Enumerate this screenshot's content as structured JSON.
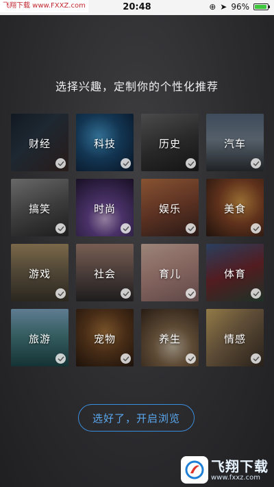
{
  "status": {
    "watermark": "飞翔下载 www.FXXZ.com",
    "time": "20:48",
    "battery_percent": "96%",
    "battery_level": 0.96
  },
  "title": "选择兴趣，定制你的个性化推荐",
  "categories": [
    {
      "label": "财经",
      "selected": true,
      "bg": "linear-gradient(135deg,#1a2430 0%,#2d3b4a 40%,#3b2a26 100%)"
    },
    {
      "label": "科技",
      "selected": true,
      "bg": "radial-gradient(circle at 40% 40%,#4aa3d8 0%,#1c4f7a 45%,#0d1d33 100%)"
    },
    {
      "label": "历史",
      "selected": true,
      "bg": "linear-gradient(160deg,#6e6e6e 0%,#3a3a3a 55%,#1e1e1e 100%)"
    },
    {
      "label": "汽车",
      "selected": true,
      "bg": "linear-gradient(180deg,#5c6f86 0%,#7d8c9c 45%,#2f3438 100%)"
    },
    {
      "label": "搞笑",
      "selected": true,
      "bg": "linear-gradient(160deg,#9a9a9a 0%,#5b5b5b 50%,#2b2b2b 100%)"
    },
    {
      "label": "时尚",
      "selected": true,
      "bg": "radial-gradient(circle at 50% 70%,#d8b9e8 0%,#6d4a9a 35%,#241836 100%)"
    },
    {
      "label": "娱乐",
      "selected": true,
      "bg": "linear-gradient(160deg,#c77a4a 0%,#8a4b34 50%,#3c2520 100%)"
    },
    {
      "label": "美食",
      "selected": true,
      "bg": "radial-gradient(circle at 60% 40%,#e0a14a 0%,#8e4a2a 45%,#2e1c14 100%)"
    },
    {
      "label": "游戏",
      "selected": true,
      "bg": "linear-gradient(180deg,#b59a6c 0%,#7a6a52 45%,#3f3a2e 100%)"
    },
    {
      "label": "社会",
      "selected": true,
      "bg": "linear-gradient(180deg,#b08a7a 0%,#6e5a55 50%,#2d2b2c 100%)"
    },
    {
      "label": "育儿",
      "selected": true,
      "bg": "linear-gradient(160deg,#e6c4b3 0%,#c3938a 50%,#8a6a6a 100%)"
    },
    {
      "label": "体育",
      "selected": true,
      "bg": "linear-gradient(160deg,#3d5e8c 0%,#7a2a30 50%,#2d4a3a 100%)"
    },
    {
      "label": "旅游",
      "selected": true,
      "bg": "linear-gradient(180deg,#8cb8d8 0%,#4f8a8e 45%,#1f4b4e 100%)"
    },
    {
      "label": "宠物",
      "selected": true,
      "bg": "radial-gradient(circle at 50% 40%,#b07a3e 0%,#6b4322 45%,#2a1a10 100%)"
    },
    {
      "label": "养生",
      "selected": true,
      "bg": "radial-gradient(circle at 55% 65%,#d8c9b0 0%,#8a6d4e 40%,#3a2a1e 100%)"
    },
    {
      "label": "情感",
      "selected": true,
      "bg": "linear-gradient(135deg,#d8b66a 0%,#8a7050 45%,#3a3026 100%)"
    }
  ],
  "cta_label": "选好了，开启浏览",
  "bottom_watermark": {
    "name": "飞翔下载",
    "url": "www.fxxz.com"
  },
  "accent_color": "#3b8fe0"
}
